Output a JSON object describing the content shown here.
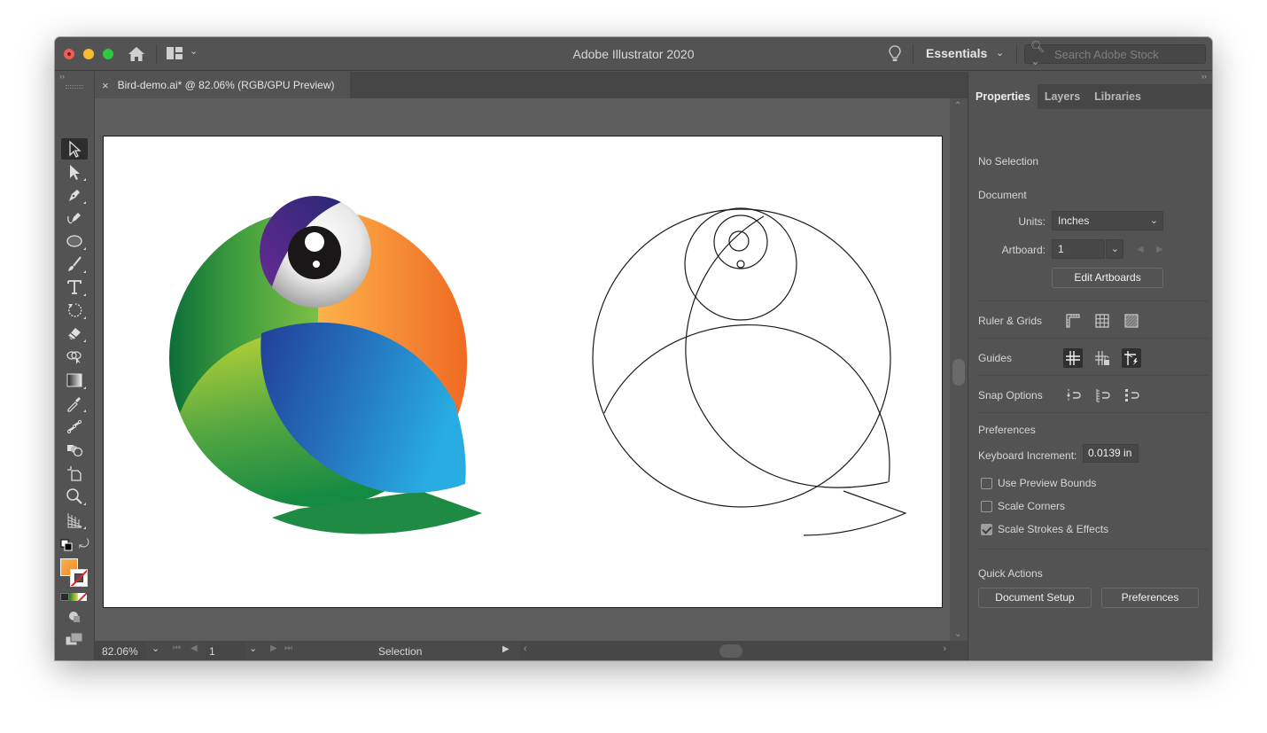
{
  "window": {
    "app_title": "Adobe Illustrator 2020",
    "workspace": "Essentials",
    "stock_search_placeholder": "Search Adobe Stock"
  },
  "document_tab": {
    "title": "Bird-demo.ai* @ 82.06% (RGB/GPU Preview)",
    "close": "×"
  },
  "toolbar": {
    "tools": [
      {
        "name": "selection-tool",
        "active": true
      },
      {
        "name": "direct-selection-tool"
      },
      {
        "name": "pen-tool"
      },
      {
        "name": "curvature-tool"
      },
      {
        "name": "ellipse-tool"
      },
      {
        "name": "paintbrush-tool"
      },
      {
        "name": "type-tool"
      },
      {
        "name": "rotate-tool"
      },
      {
        "name": "eraser-tool"
      },
      {
        "name": "shape-builder-tool"
      },
      {
        "name": "gradient-tool"
      },
      {
        "name": "eyedropper-tool"
      },
      {
        "name": "puppet-warp-tool"
      },
      {
        "name": "blend-tool"
      },
      {
        "name": "artboard-tool"
      },
      {
        "name": "zoom-tool"
      },
      {
        "name": "perspective-grid-tool"
      }
    ],
    "fill_color": "#f59a3a",
    "stroke": "none",
    "more": "•••"
  },
  "statusbar": {
    "zoom": "82.06%",
    "artboard_number": "1",
    "status": "Selection"
  },
  "artwork": {
    "colors": {
      "green_dark": "#0f7a3a",
      "green_light": "#b7d234",
      "orange": "#f7a03a",
      "orange_dark": "#ef6a23",
      "blue_dark": "#1f3f9a",
      "blue_light": "#27aae1",
      "purple": "#5a2a8e"
    }
  },
  "properties_panel": {
    "tabs": [
      "Properties",
      "Layers",
      "Libraries"
    ],
    "active_tab": "Properties",
    "selection_state": "No Selection",
    "document_heading": "Document",
    "units_label": "Units:",
    "units_value": "Inches",
    "artboard_label": "Artboard:",
    "artboard_value": "1",
    "edit_artboards": "Edit Artboards",
    "ruler_grids_label": "Ruler & Grids",
    "guides_label": "Guides",
    "snap_options_label": "Snap Options",
    "preferences_heading": "Preferences",
    "keyboard_increment_label": "Keyboard Increment:",
    "keyboard_increment_value": "0.0139 in",
    "checkboxes": [
      {
        "label": "Use Preview Bounds",
        "checked": false
      },
      {
        "label": "Scale Corners",
        "checked": false
      },
      {
        "label": "Scale Strokes & Effects",
        "checked": true
      }
    ],
    "quick_actions_heading": "Quick Actions",
    "document_setup_button": "Document Setup",
    "preferences_button": "Preferences"
  }
}
